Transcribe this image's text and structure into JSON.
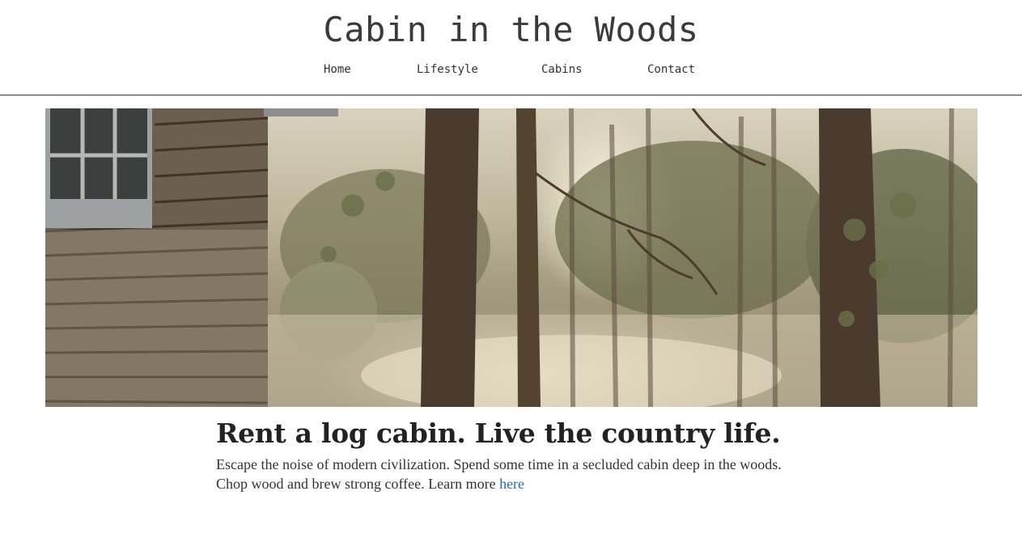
{
  "site": {
    "title": "Cabin in the Woods"
  },
  "nav": {
    "items": [
      {
        "label": "Home"
      },
      {
        "label": "Lifestyle"
      },
      {
        "label": "Cabins"
      },
      {
        "label": "Contact"
      }
    ]
  },
  "hero": {
    "image_subject": "log cabin wall beside a misty forest lake",
    "colors": {
      "mist": "#e9e0c9",
      "trunk": "#4a3b2e",
      "foliage": "#5d6245",
      "log_wall": "#6d5f4f"
    }
  },
  "content": {
    "headline": "Rent a log cabin. Live the country life.",
    "intro_text": "Escape the noise of modern civilization. Spend some time in a secluded cabin deep in the woods. Chop wood and brew strong coffee. Learn more ",
    "link_label": "here",
    "link_color": "#2a6ab3"
  }
}
